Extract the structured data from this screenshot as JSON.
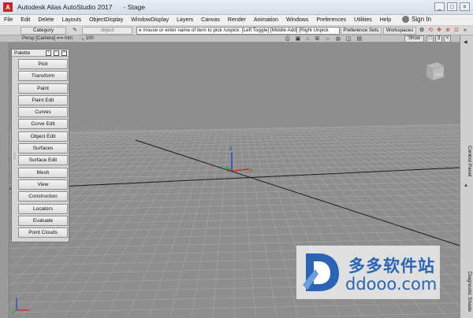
{
  "window": {
    "title": "Autodesk Alias AutoStudio 2017",
    "document": "- Stage",
    "controls": [
      "_",
      "□",
      "×"
    ],
    "app_icon": "A"
  },
  "menu": {
    "items": [
      "File",
      "Edit",
      "Delete",
      "Layouts",
      "ObjectDisplay",
      "WindowDisplay",
      "Layers",
      "Canvas",
      "Render",
      "Animation",
      "Windows",
      "Preferences",
      "Utilities",
      "Help"
    ],
    "sign_in": "Sign In"
  },
  "toolbar": {
    "category_label": "Category",
    "object_field": "object",
    "prompt": "e mouse or enter name of item to pick /unpick: [Left Toggle] [Middle Add] [Right Unpick",
    "preference_sets": "Preference Sets",
    "workspaces": "Workspaces"
  },
  "viewport": {
    "label": "Persp [Camera] ⟺ mm",
    "zoom": "100",
    "show_button": "Show",
    "layout_button": "3",
    "view_cube_face": "LEFT",
    "grid_color": "#a7a7a7",
    "bg_color": "#8e8e8e",
    "axes": {
      "x_label": "x",
      "y_label": "y",
      "z_label": "z",
      "x_color": "#d42020",
      "y_color": "#1fa31f",
      "z_color": "#2040d8"
    }
  },
  "palette": {
    "title": "Palette",
    "items": [
      "Pick",
      "Transform",
      "Paint",
      "Paint Edit",
      "Curves",
      "Curve Edit",
      "Object Edit",
      "Surfaces",
      "Surface Edit",
      "Mesh",
      "View",
      "Construction",
      "Locators",
      "Evaluate",
      "Point Clouds"
    ]
  },
  "right_panel": {
    "control_panel": "Control Panel",
    "diagnostic_shade": "Diagnostic Shade"
  },
  "watermark": {
    "cn_text": "多多软件站",
    "url": "ddooo.com",
    "color": "#2a64b3"
  }
}
